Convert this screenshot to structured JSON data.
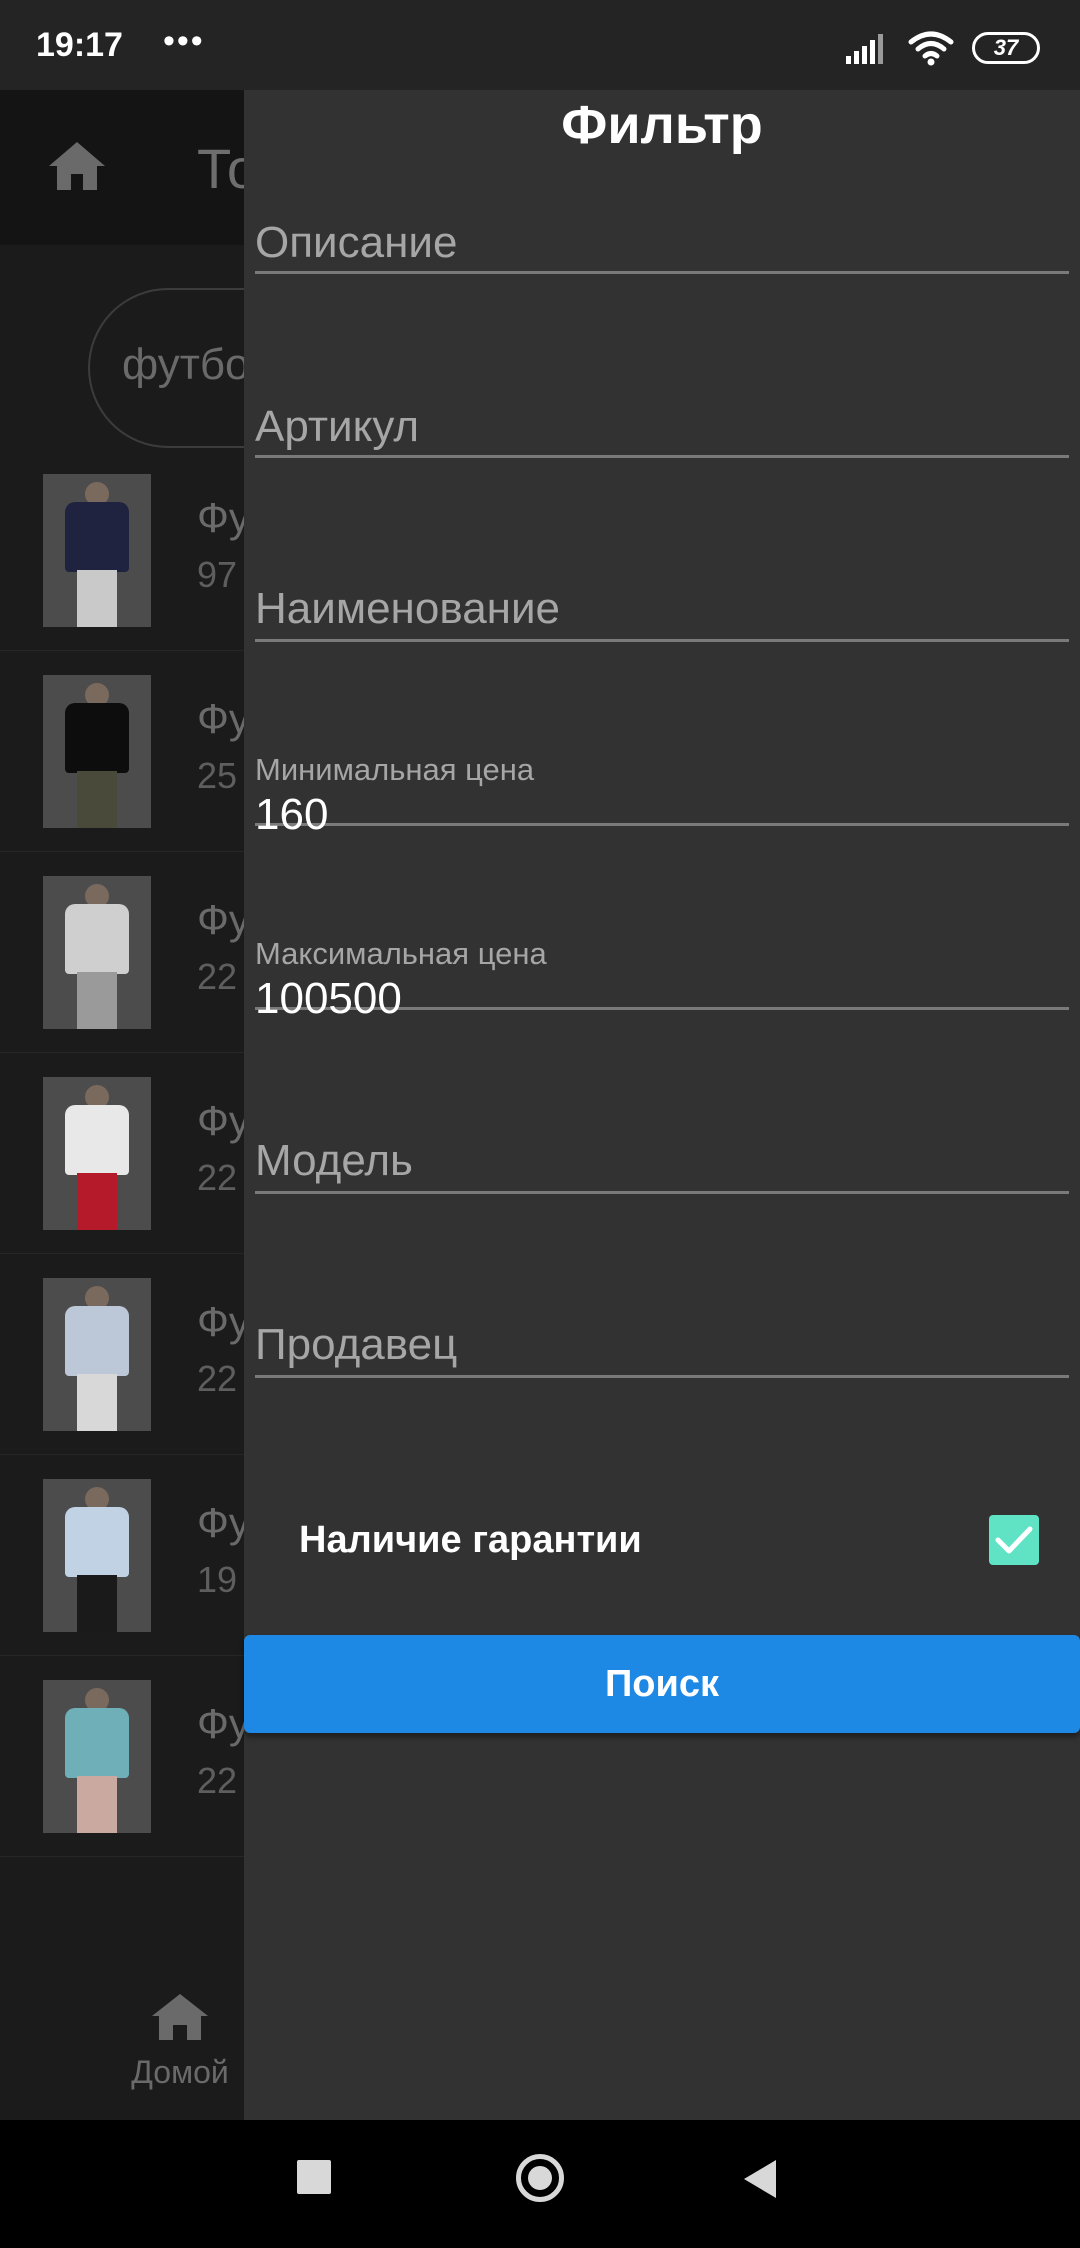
{
  "status_bar": {
    "time": "19:17",
    "dots": "•••",
    "battery": "37"
  },
  "background_page": {
    "title": "То",
    "search_text": "футбо",
    "items": [
      {
        "name": "Фу",
        "price": "97",
        "shirt_color": "#1f2340",
        "legs_color": "#c9c9c9"
      },
      {
        "name": "Фу",
        "price": "25",
        "shirt_color": "#0d0d0d",
        "legs_color": "#4a4a3a"
      },
      {
        "name": "Фу",
        "price": "22",
        "shirt_color": "#cfcfcf",
        "legs_color": "#9a9a9a"
      },
      {
        "name": "Фу",
        "price": "22",
        "shirt_color": "#e8e8e8",
        "legs_color": "#b51a2a"
      },
      {
        "name": "Фу",
        "price": "22",
        "shirt_color": "#bcc8d8",
        "legs_color": "#d8d8d8"
      },
      {
        "name": "Фу",
        "price": "19",
        "shirt_color": "#c0d2e4",
        "legs_color": "#1a1a1a"
      },
      {
        "name": "Фу",
        "price": "22",
        "shirt_color": "#6fb0b8",
        "legs_color": "#caa9a0"
      }
    ],
    "bottom_nav_label": "Домой"
  },
  "drawer": {
    "title": "Фильтр",
    "fields": {
      "description": {
        "placeholder": "Описание"
      },
      "article": {
        "placeholder": "Артикул"
      },
      "name": {
        "placeholder": "Наименование"
      },
      "min_price": {
        "label": "Минимальная цена",
        "value": "160"
      },
      "max_price": {
        "label": "Максимальная цена",
        "value": "100500"
      },
      "model": {
        "placeholder": "Модель"
      },
      "seller": {
        "placeholder": "Продавец"
      }
    },
    "warranty": {
      "label": "Наличие гарантии",
      "checked": true
    },
    "search_button": "Поиск"
  },
  "colors": {
    "accent": "#1e88e5",
    "checkbox": "#5fe3c4",
    "drawer_bg": "#323232"
  }
}
